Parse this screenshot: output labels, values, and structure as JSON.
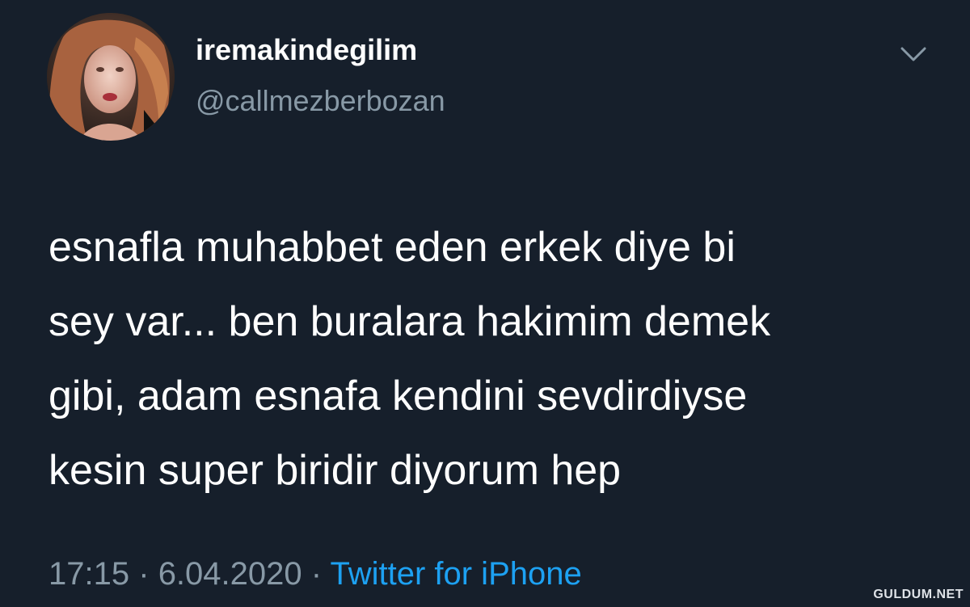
{
  "tweet": {
    "author": {
      "display_name": "iremakindegilim",
      "handle": "@callmezberbozan",
      "avatar_icon": "profile-photo"
    },
    "menu_icon": "chevron-down-icon",
    "text_lines": [
      "esnafla muhabbet eden erkek diye bi",
      "sey var... ben buralara hakimim demek",
      "gibi, adam esnafa kendini sevdirdiyse",
      "kesin super biridir diyorum hep"
    ],
    "time": "17:15",
    "separator": "·",
    "date": "6.04.2020",
    "source": "Twitter for iPhone"
  },
  "watermark": "GULDUM.NET",
  "colors": {
    "background": "#161f2b",
    "primary_text": "#ffffff",
    "secondary_text": "#8899a6",
    "link": "#1da1f2"
  }
}
